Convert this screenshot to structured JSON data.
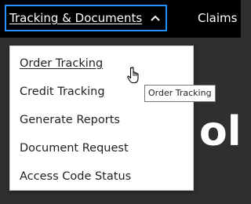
{
  "nav": {
    "active_menu_label": "Tracking & Documents",
    "active_menu_icon": "chevron-up-icon",
    "next_menu_label": "Claims"
  },
  "background": {
    "heading_fragment": "ol"
  },
  "dropdown": {
    "items": [
      {
        "label": "Order Tracking"
      },
      {
        "label": "Credit Tracking"
      },
      {
        "label": "Generate Reports"
      },
      {
        "label": "Document Request"
      },
      {
        "label": "Access Code Status"
      }
    ],
    "hovered_item": "Order Tracking"
  },
  "tooltip": {
    "text": "Order Tracking"
  },
  "cursor": {
    "icon": "hand-pointer-icon"
  },
  "colors": {
    "nav_background": "#000000",
    "focus_outline": "#1e90ff",
    "page_background": "#2f2f2f",
    "dropdown_background": "#ffffff"
  }
}
